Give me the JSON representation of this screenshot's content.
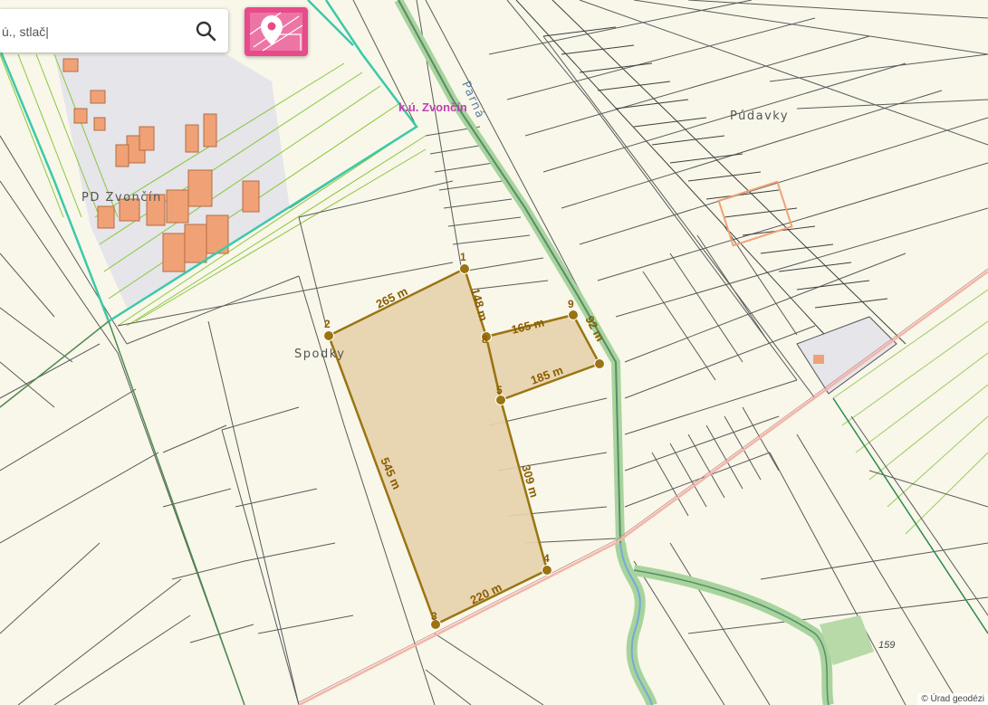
{
  "search": {
    "placeholder": "ú., stlač|"
  },
  "map": {
    "cadastral_label": "k.ú. Zvončín",
    "places": {
      "spodky": "Spodky",
      "pd_zvoncin": "PD Zvončín",
      "pudavky": "Púdavky",
      "river": "Parná"
    },
    "parcel_number": "159",
    "measurements": {
      "m_2_1": "265 m",
      "m_1_8": "148 m",
      "m_a": "165 m",
      "m_b": "92 m",
      "m_c": "185 m",
      "m_4_5": "309 m",
      "m_2_3": "545 m",
      "m_3_4": "220 m"
    },
    "vertex_labels": {
      "v1": "1",
      "v2": "2",
      "v3": "3",
      "v4": "4",
      "v5": "5",
      "v8": "8",
      "v9": "9"
    },
    "colors": {
      "measure_stroke": "#9b7412",
      "measure_fill": "#e6d3ac",
      "cadastral_border": "#3cc9a8",
      "parcel_line": "#5a5a5a",
      "green_hatch": "#8ac63a",
      "building": "#f0a276"
    }
  },
  "attribution": "© Úrad geodézi"
}
